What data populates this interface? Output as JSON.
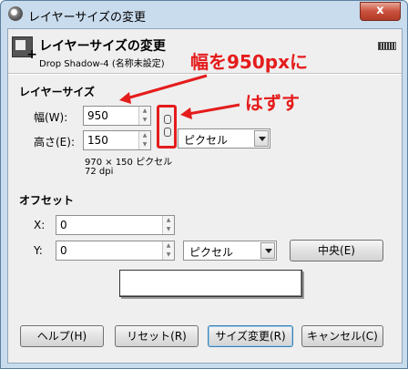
{
  "window": {
    "title": "レイヤーサイズの変更",
    "close_label": "x"
  },
  "header": {
    "title": "レイヤーサイズの変更",
    "subtitle": "Drop Shadow-4 (名称未設定)"
  },
  "layer_size": {
    "section_title": "レイヤーサイズ",
    "width_label": "幅(W):",
    "width_value": "950",
    "height_label": "高さ(E):",
    "height_value": "150",
    "unit": "ピクセル",
    "size_info": "970 × 150 ピクセル",
    "dpi_info": "72 dpi"
  },
  "offset": {
    "section_title": "オフセット",
    "x_label": "X:",
    "x_value": "0",
    "y_label": "Y:",
    "y_value": "0",
    "unit": "ピクセル",
    "center_button": "中央(E)"
  },
  "buttons": {
    "help": "ヘルプ(H)",
    "reset": "リセット(R)",
    "resize": "サイズ変更(R)",
    "cancel": "キャンセル(C)"
  },
  "annotations": {
    "width_note": "幅を950pxに",
    "unlink_note": "はずす",
    "color": "#e51c1c"
  }
}
